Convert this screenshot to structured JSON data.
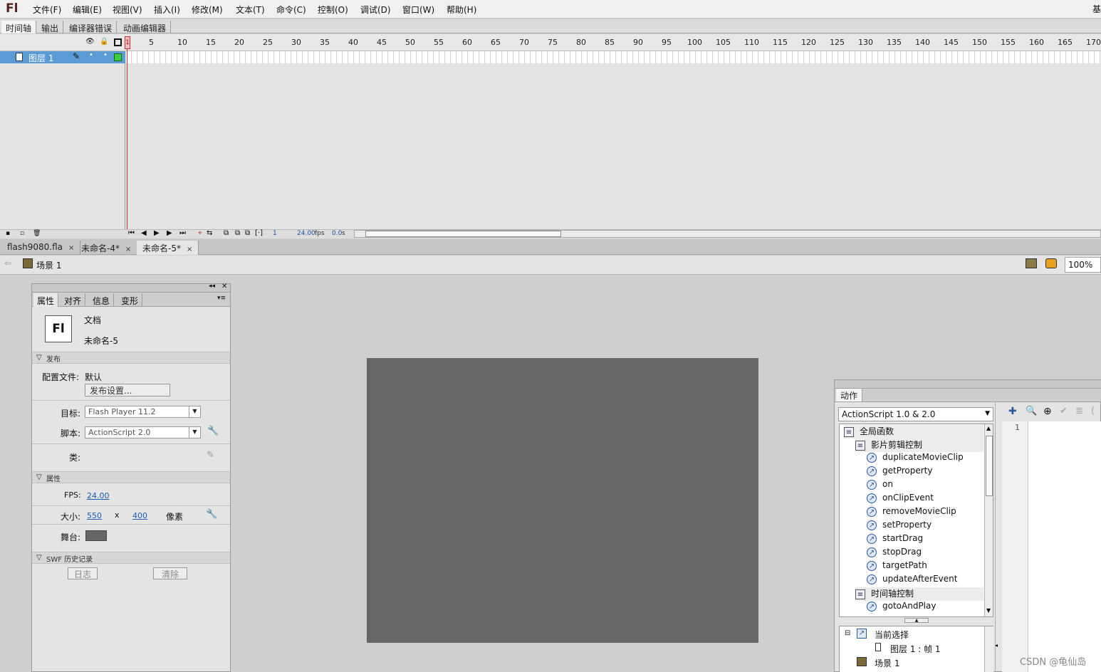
{
  "app": {
    "logo": "Fl"
  },
  "menu": [
    "文件(F)",
    "编辑(E)",
    "视图(V)",
    "插入(I)",
    "修改(M)",
    "文本(T)",
    "命令(C)",
    "控制(O)",
    "调试(D)",
    "窗口(W)",
    "帮助(H)"
  ],
  "corner_label": "基",
  "panel_tabs": [
    "时间轴",
    "输出",
    "编译器错误",
    "动画编辑器"
  ],
  "timeline": {
    "ticks": [
      "1",
      "5",
      "10",
      "15",
      "20",
      "25",
      "30",
      "35",
      "40",
      "45",
      "50",
      "55",
      "60",
      "65",
      "70",
      "75",
      "80",
      "85",
      "90",
      "95",
      "100",
      "105",
      "110",
      "115",
      "120",
      "125",
      "130",
      "135",
      "140",
      "145",
      "150",
      "155",
      "160",
      "165",
      "170"
    ],
    "layer_name": "图层 1",
    "current_frame": "1",
    "fps": "24.00",
    "fps_unit": "fps",
    "time": "0.0",
    "time_unit": "s",
    "frame_box": "1"
  },
  "doc_tabs": [
    {
      "label": "flash9080.fla",
      "close": "×",
      "active": false
    },
    {
      "label": "未命名-4*",
      "close": "×",
      "active": false
    },
    {
      "label": "未命名-5*",
      "close": "×",
      "active": true
    }
  ],
  "scene": {
    "label": "场景 1",
    "zoom": "100%"
  },
  "properties": {
    "tabs": [
      "属性",
      "对齐",
      "信息",
      "变形"
    ],
    "doc_icon": "Fl",
    "doc_type": "文档",
    "doc_name": "未命名-5",
    "publish_section": "发布",
    "profile_label": "配置文件:",
    "profile_value": "默认",
    "publish_settings_button": "发布设置...",
    "target_label": "目标:",
    "target_value": "Flash Player 11.2",
    "script_label": "脚本:",
    "script_value": "ActionScript 2.0",
    "class_label": "类:",
    "props_section": "属性",
    "fps_label": "FPS:",
    "fps_value": "24.00",
    "size_label": "大小:",
    "width": "550",
    "size_x": "x",
    "height": "400",
    "size_unit": "像素",
    "stage_label": "舞台:",
    "stage_color": "#666666",
    "swf_section": "SWF 历史记录",
    "log_button": "日志",
    "clear_button": "清除"
  },
  "actions": {
    "tab": "动作",
    "language": "ActionScript 1.0 & 2.0",
    "tree": [
      {
        "label": "全局函数",
        "type": "book",
        "level": 0
      },
      {
        "label": "影片剪辑控制",
        "type": "book",
        "level": 1
      },
      {
        "label": "duplicateMovieClip",
        "type": "fn",
        "level": 2
      },
      {
        "label": "getProperty",
        "type": "fn",
        "level": 2
      },
      {
        "label": "on",
        "type": "fn",
        "level": 2
      },
      {
        "label": "onClipEvent",
        "type": "fn",
        "level": 2
      },
      {
        "label": "removeMovieClip",
        "type": "fn",
        "level": 2
      },
      {
        "label": "setProperty",
        "type": "fn",
        "level": 2
      },
      {
        "label": "startDrag",
        "type": "fn",
        "level": 2
      },
      {
        "label": "stopDrag",
        "type": "fn",
        "level": 2
      },
      {
        "label": "targetPath",
        "type": "fn",
        "level": 2
      },
      {
        "label": "updateAfterEvent",
        "type": "fn",
        "level": 2
      },
      {
        "label": "时间轴控制",
        "type": "book",
        "level": 1
      },
      {
        "label": "gotoAndPlay",
        "type": "fn",
        "level": 2
      }
    ],
    "selection": {
      "current": "当前选择",
      "frame": "图层 1 : 帧 1",
      "scene": "场景 1"
    },
    "line_number": "1"
  },
  "watermark": "CSDN @龟仙岛"
}
